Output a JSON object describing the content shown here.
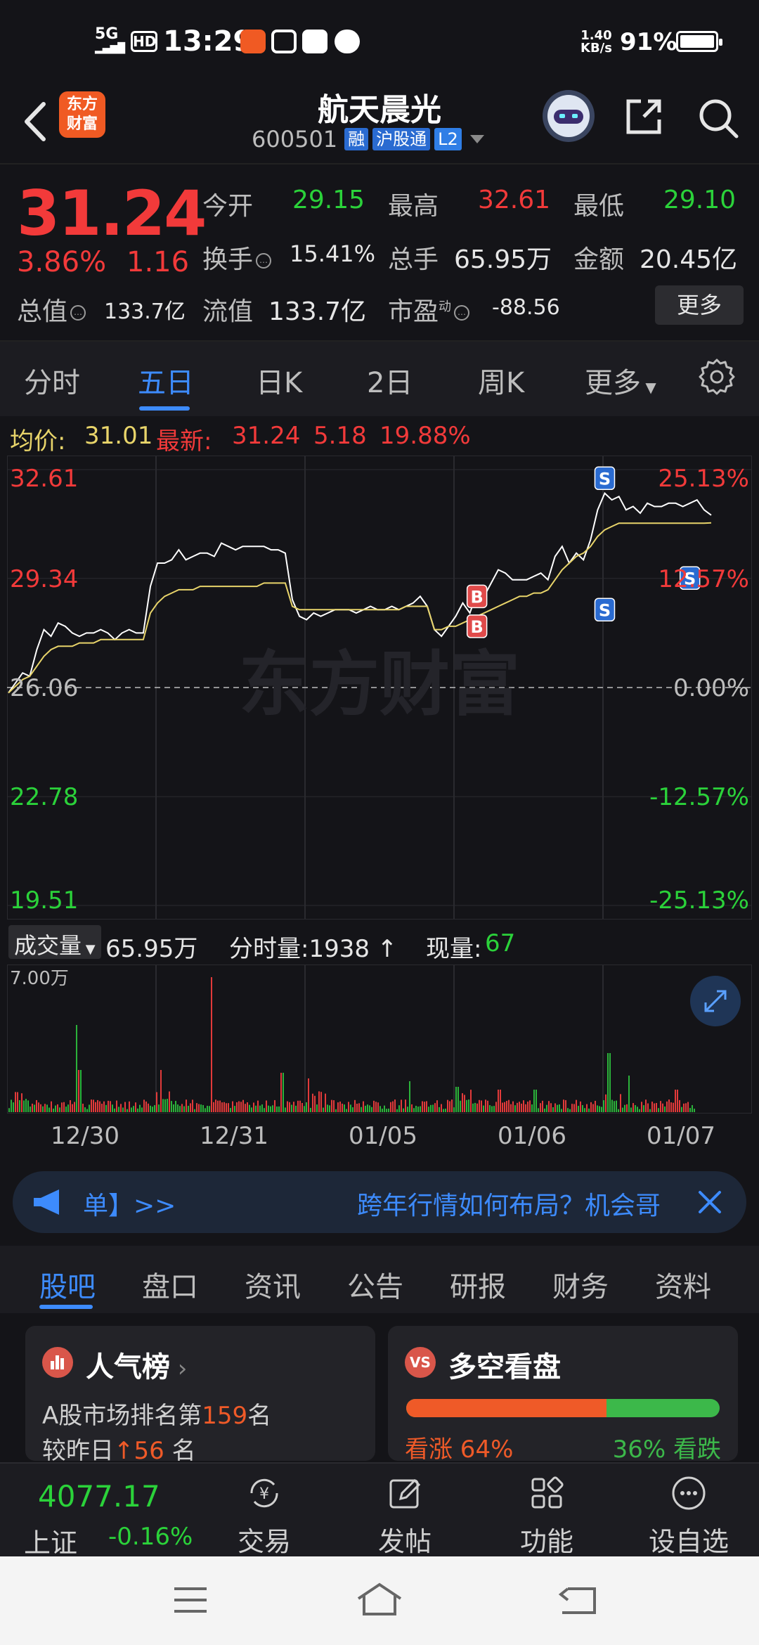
{
  "status_bar": {
    "network": "5G",
    "hd": "HD",
    "time": "13:29",
    "speed_value": "1.40",
    "speed_unit": "KB/s",
    "battery": "91%"
  },
  "header": {
    "logo_line1": "东方",
    "logo_line2": "财富",
    "stock_name": "航天晨光",
    "stock_code": "600501",
    "tag_margin": "融",
    "tag_connect": "沪股通",
    "tag_level": "L2"
  },
  "quote": {
    "price": "31.24",
    "change_pct": "3.86%",
    "change_amt": "1.16",
    "open_label": "今开",
    "open_value": "29.15",
    "high_label": "最高",
    "high_value": "32.61",
    "low_label": "最低",
    "low_value": "29.10",
    "turnover_label": "换手",
    "turnover_value": "15.41%",
    "volume_label": "总手",
    "volume_value": "65.95万",
    "amount_label": "金额",
    "amount_value": "20.45亿",
    "mktcap_label": "总值",
    "mktcap_value": "133.7亿",
    "float_label": "流值",
    "float_value": "133.7亿",
    "pe_label": "市盈",
    "pe_sup": "动",
    "pe_value": "-88.56",
    "more_button": "更多"
  },
  "period_tabs": {
    "items": [
      "分时",
      "五日",
      "日K",
      "2日",
      "周K",
      "更多"
    ],
    "active_index": 1
  },
  "chart_header": {
    "avg_label": "均价:",
    "avg_value": "31.01",
    "latest_label": "最新:",
    "latest_value": "31.24",
    "latest_chg": "5.18",
    "latest_pct": "19.88%"
  },
  "chart_data": {
    "type": "line",
    "y_ticks_left": [
      "32.61",
      "29.34",
      "26.06",
      "22.78",
      "19.51"
    ],
    "y_ticks_right": [
      "25.13%",
      "12.57%",
      "0.00%",
      "-12.57%",
      "-25.13%"
    ],
    "ylim": [
      19.51,
      32.61
    ],
    "baseline": 26.06,
    "watermark": "东方财富",
    "days": [
      "12/30",
      "12/31",
      "01/05",
      "01/06",
      "01/07"
    ],
    "series": [
      {
        "name": "价格",
        "color": "#ffffff",
        "values": [
          25.9,
          26.2,
          26.5,
          26.4,
          27.2,
          27.8,
          27.6,
          28.0,
          27.9,
          27.7,
          27.6,
          27.7,
          27.7,
          27.8,
          27.7,
          27.5,
          27.7,
          27.8,
          27.7,
          27.7,
          29.1,
          29.8,
          29.8,
          29.9,
          30.2,
          29.9,
          30.0,
          30.1,
          30.1,
          30.0,
          30.4,
          30.3,
          30.2,
          30.3,
          30.3,
          30.3,
          30.3,
          30.2,
          30.2,
          30.1,
          28.7,
          28.2,
          28.1,
          28.3,
          28.2,
          28.3,
          28.4,
          28.4,
          28.4,
          28.3,
          28.4,
          28.5,
          28.4,
          28.4,
          28.5,
          28.4,
          28.5,
          28.6,
          28.8,
          28.5,
          27.8,
          27.6,
          27.9,
          28.2,
          28.6,
          28.3,
          28.9,
          28.8,
          29.2,
          29.6,
          29.5,
          29.3,
          29.3,
          29.3,
          29.4,
          29.5,
          29.3,
          30.0,
          30.3,
          29.8,
          30.1,
          29.9,
          30.5,
          31.4,
          31.9,
          31.7,
          31.8,
          31.4,
          31.5,
          31.3,
          31.6,
          31.5,
          31.5,
          31.6,
          31.6,
          31.5,
          31.6,
          31.7,
          31.4,
          31.24
        ]
      },
      {
        "name": "均价",
        "color": "#e8d46a",
        "values": [
          25.9,
          26.1,
          26.3,
          26.4,
          26.7,
          27.0,
          27.2,
          27.3,
          27.3,
          27.3,
          27.4,
          27.4,
          27.4,
          27.5,
          27.5,
          27.5,
          27.5,
          27.5,
          27.5,
          27.5,
          28.3,
          28.6,
          28.8,
          28.9,
          29.0,
          29.0,
          29.0,
          29.1,
          29.1,
          29.1,
          29.1,
          29.1,
          29.1,
          29.1,
          29.1,
          29.1,
          29.2,
          29.2,
          29.2,
          29.2,
          28.5,
          28.4,
          28.4,
          28.4,
          28.4,
          28.4,
          28.4,
          28.4,
          28.4,
          28.4,
          28.4,
          28.4,
          28.4,
          28.4,
          28.4,
          28.4,
          28.5,
          28.5,
          28.5,
          28.5,
          27.8,
          27.8,
          27.9,
          27.9,
          28.0,
          28.1,
          28.2,
          28.3,
          28.4,
          28.5,
          28.6,
          28.7,
          28.8,
          28.8,
          28.9,
          28.9,
          29.0,
          29.3,
          29.6,
          29.8,
          30.0,
          30.1,
          30.3,
          30.6,
          30.8,
          30.9,
          31.0,
          31.0,
          31.0,
          31.0,
          31.0,
          31.0,
          31.0,
          31.0,
          31.0,
          31.0,
          31.0,
          31.0,
          31.0,
          31.01
        ]
      }
    ],
    "markers": [
      {
        "label": "B",
        "index": 66,
        "value": 28.8,
        "color": "#e04a4a"
      },
      {
        "label": "B",
        "index": 66,
        "value": 27.9,
        "color": "#e04a4a"
      },
      {
        "label": "S",
        "index": 84,
        "value": 32.35,
        "color": "#2a6bd1"
      },
      {
        "label": "S",
        "index": 84,
        "value": 28.4,
        "color": "#2a6bd1"
      },
      {
        "label": "S",
        "index": 96,
        "value": 29.35,
        "color": "#2a6bd1"
      }
    ]
  },
  "volume": {
    "selector_label": "成交量",
    "total_value": "65.95万",
    "tick_label": "分时量:1938",
    "now_label": "现量:",
    "now_value": "67",
    "max_label": "7.00万"
  },
  "banner": {
    "left_text": "单】>>",
    "headline": "跨年行情如何布局？机会哥"
  },
  "news_tabs": {
    "items": [
      "股吧",
      "盘口",
      "资讯",
      "公告",
      "研报",
      "财务",
      "资料"
    ],
    "active_index": 0
  },
  "popularity_card": {
    "title": "人气榜",
    "rank_prefix": "A股市场排名第",
    "rank_value": "159",
    "rank_suffix": "名",
    "change_prefix": "较昨日",
    "change_value": "56",
    "change_suffix": "名"
  },
  "sentiment_card": {
    "icon_text": "VS",
    "title": "多空看盘",
    "bull_label": "看涨 64%",
    "bear_label": "36% 看跌",
    "bull_fraction": 0.64,
    "bull_color": "#ef5a28",
    "bear_color": "#3cb84a"
  },
  "bottom_bar": {
    "index_value": "4077.17",
    "index_name": "上证",
    "index_change": "-0.16%",
    "trade_label": "交易",
    "post_label": "发帖",
    "function_label": "功能",
    "watchlist_label": "设自选"
  }
}
